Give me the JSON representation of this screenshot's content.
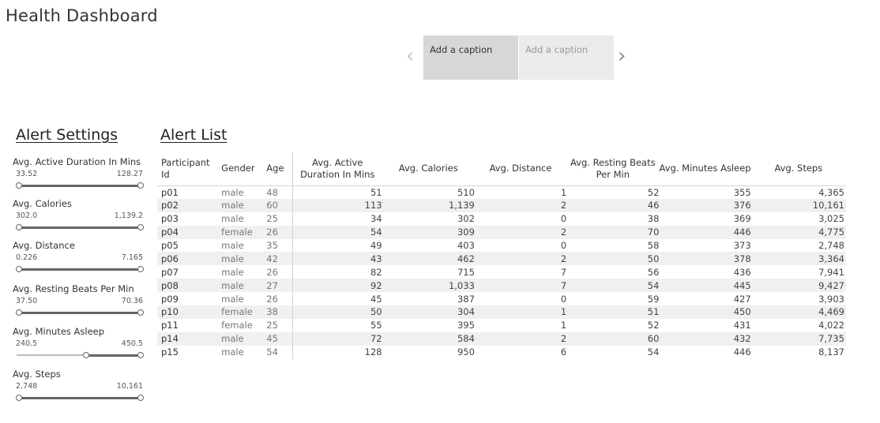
{
  "header": {
    "title": "Health Dashboard"
  },
  "story": {
    "prev_icon": "chevron-left-icon",
    "next_icon": "chevron-right-icon",
    "points": [
      {
        "caption": "Add a caption"
      },
      {
        "caption": "Add a caption"
      }
    ]
  },
  "alert_settings": {
    "heading": "Alert Settings",
    "filters": [
      {
        "label": "Avg. Active Duration In Mins",
        "min": "33.52",
        "max": "128.27",
        "low": 0.0,
        "high": 1.0
      },
      {
        "label": "Avg. Calories",
        "min": "302.0",
        "max": "1,139.2",
        "low": 0.0,
        "high": 1.0
      },
      {
        "label": "Avg. Distance",
        "min": "0.226",
        "max": "7.165",
        "low": 0.0,
        "high": 1.0
      },
      {
        "label": "Avg. Resting Beats Per Min",
        "min": "37.50",
        "max": "70.36",
        "low": 0.0,
        "high": 1.0
      },
      {
        "label": "Avg. Minutes Asleep",
        "min": "240.5",
        "max": "450.5",
        "low": 0.55,
        "high": 1.0
      },
      {
        "label": "Avg. Steps",
        "min": "2,748",
        "max": "10,161",
        "low": 0.0,
        "high": 1.0
      }
    ]
  },
  "alert_list": {
    "heading": "Alert List",
    "columns": {
      "id": "Participant Id",
      "gender": "Gender",
      "age": "Age",
      "duration": "Avg. Active Duration In Mins",
      "calories": "Avg. Calories",
      "distance": "Avg. Distance",
      "resting": "Avg. Resting Beats Per Min",
      "sleep": "Avg. Minutes Asleep",
      "steps": "Avg. Steps"
    },
    "rows": [
      [
        "p01",
        "male",
        "48",
        "51",
        "510",
        "1",
        "52",
        "355",
        "4,365"
      ],
      [
        "p02",
        "male",
        "60",
        "113",
        "1,139",
        "2",
        "46",
        "376",
        "10,161"
      ],
      [
        "p03",
        "male",
        "25",
        "34",
        "302",
        "0",
        "38",
        "369",
        "3,025"
      ],
      [
        "p04",
        "female",
        "26",
        "54",
        "309",
        "2",
        "70",
        "446",
        "4,775"
      ],
      [
        "p05",
        "male",
        "35",
        "49",
        "403",
        "0",
        "58",
        "373",
        "2,748"
      ],
      [
        "p06",
        "male",
        "42",
        "43",
        "462",
        "2",
        "50",
        "378",
        "3,364"
      ],
      [
        "p07",
        "male",
        "26",
        "82",
        "715",
        "7",
        "56",
        "436",
        "7,941"
      ],
      [
        "p08",
        "male",
        "27",
        "92",
        "1,033",
        "7",
        "54",
        "445",
        "9,427"
      ],
      [
        "p09",
        "male",
        "26",
        "45",
        "387",
        "0",
        "59",
        "427",
        "3,903"
      ],
      [
        "p10",
        "female",
        "38",
        "50",
        "304",
        "1",
        "51",
        "450",
        "4,469"
      ],
      [
        "p11",
        "female",
        "25",
        "55",
        "395",
        "1",
        "52",
        "431",
        "4,022"
      ],
      [
        "p14",
        "male",
        "45",
        "72",
        "584",
        "2",
        "60",
        "432",
        "7,735"
      ],
      [
        "p15",
        "male",
        "54",
        "128",
        "950",
        "6",
        "54",
        "446",
        "8,137"
      ]
    ]
  }
}
